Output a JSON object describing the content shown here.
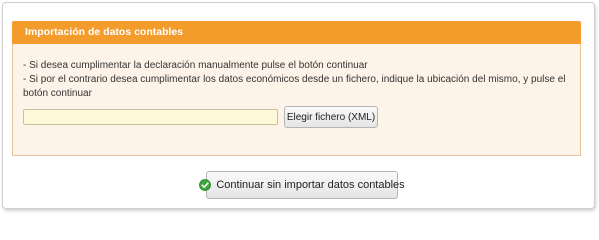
{
  "panel": {
    "title": "Importación de datos contables",
    "line1": "- Si desea cumplimentar la declaración manualmente pulse el botón continuar",
    "line2": "- Si por el contrario desea cumplimentar los datos económicos desde un fichero, indique la ubicación del mismo, y pulse el botón continuar",
    "file_input_value": "",
    "choose_file_label": "Elegir fichero (XML)"
  },
  "footer": {
    "continue_label": "Continuar sin importar datos contables",
    "continue_icon": "check-circle-icon"
  },
  "colors": {
    "header": "#f39c2c",
    "panel_bg": "#fdf3e8",
    "input_bg": "#fdf9d8",
    "check_green": "#3aa63a"
  }
}
